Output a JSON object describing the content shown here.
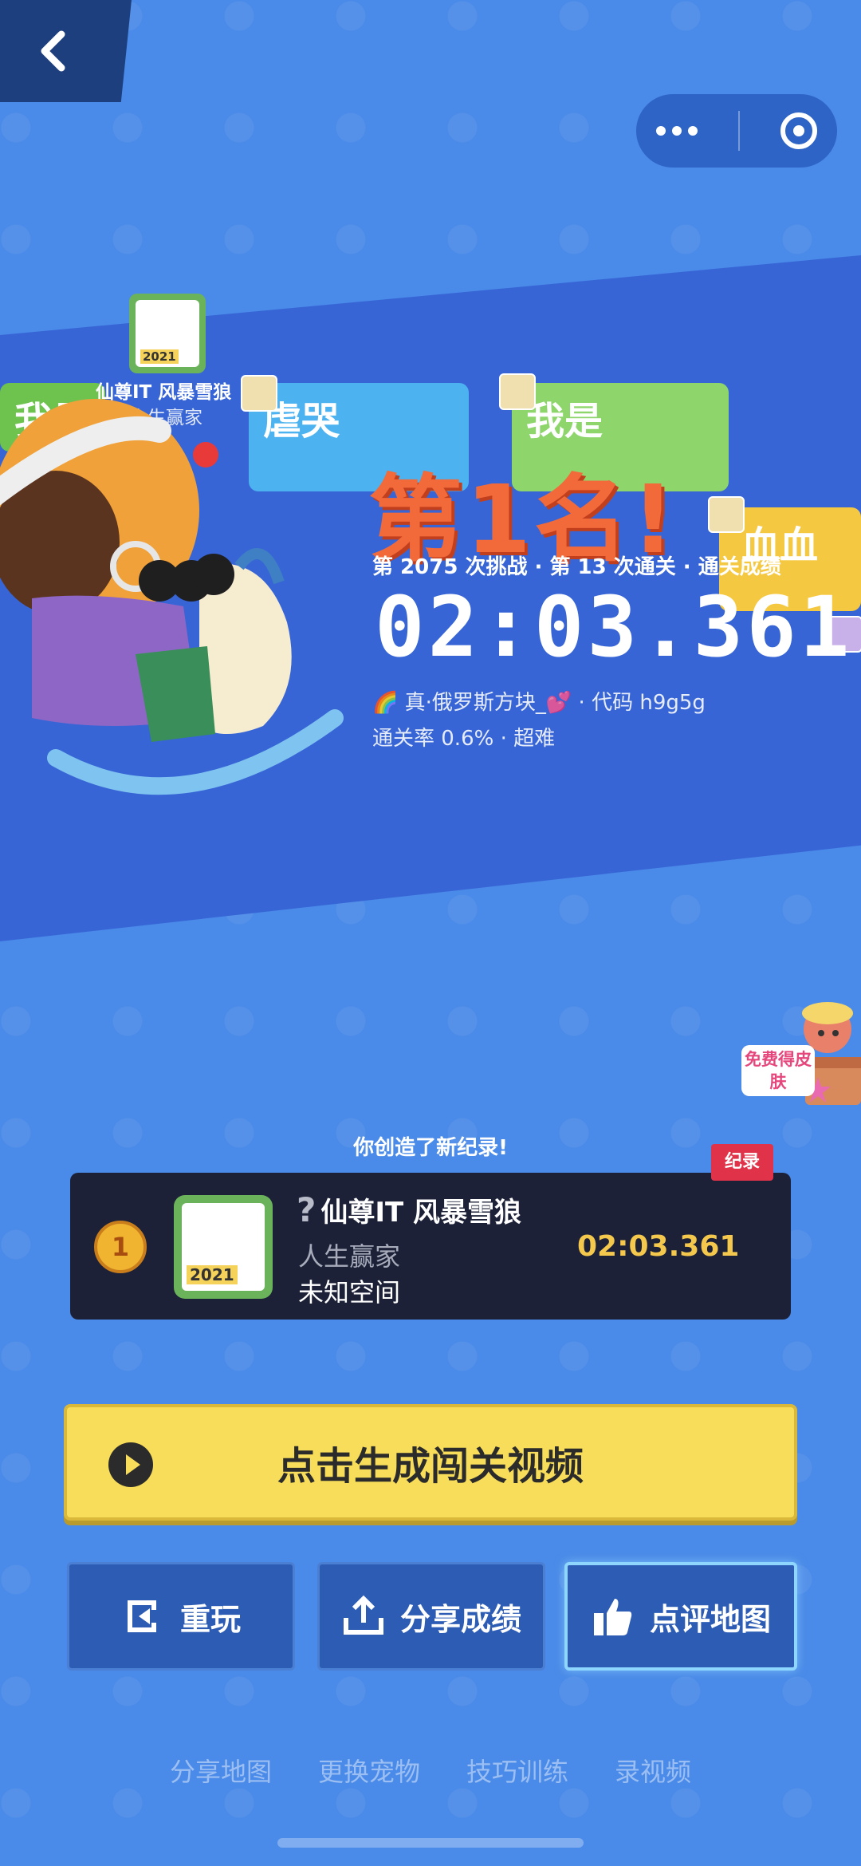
{
  "nav": {
    "back_icon": "chevron-left-icon",
    "more_icon": "more-dots-icon",
    "close_icon": "target-circle-icon"
  },
  "banner": {
    "rank_text": "第1名!",
    "challenge_line": "第 2075 次挑战 · 第 13 次通关 · 通关成绩",
    "time": "02:03.361",
    "level_line": "🌈 真·俄罗斯方块_💕 · 代码 h9g5g",
    "rate_line": "通关率 0.6% · 超难",
    "player_tag_name": "仙尊IT 风暴雪狼",
    "player_tag_title": "人生赢家",
    "avatar_year": "2021",
    "bullets": [
      "我是",
      "虐哭",
      "我是",
      "血血"
    ]
  },
  "promo": {
    "free_skin": "免费得皮肤"
  },
  "record": {
    "notice": "你创造了新纪录!",
    "tag": "纪录",
    "rank": "1",
    "name_prefix": "?",
    "name": "仙尊IT 风暴雪狼",
    "title": "人生赢家",
    "space": "未知空间",
    "time": "02:03.361",
    "avatar_year": "2021"
  },
  "buttons": {
    "generate_video": "点击生成闯关视频",
    "replay": "重玩",
    "share_score": "分享成绩",
    "review_map": "点评地图"
  },
  "footer": {
    "links": [
      "分享地图",
      "更换宠物",
      "技巧训练",
      "录视频"
    ]
  },
  "colors": {
    "accent_yellow": "#f7dd5a",
    "rank_orange": "#f26a3a",
    "record_red": "#e0334a",
    "bg_blue": "#4a8ae8"
  }
}
